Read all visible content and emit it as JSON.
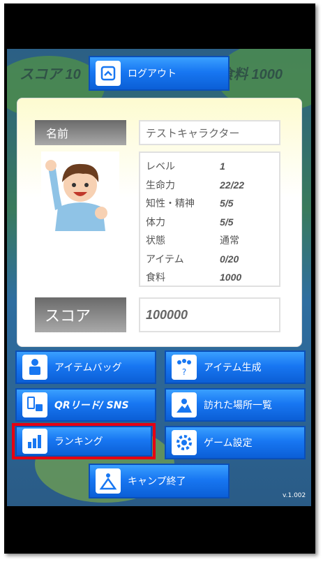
{
  "header": {
    "bg_score": "スコア 10",
    "bg_food": "食料 1000",
    "logout_label": "ログアウト"
  },
  "profile": {
    "name_label": "名前",
    "name_value": "テストキャラクター",
    "stats": [
      {
        "key": "レベル",
        "value": "1"
      },
      {
        "key": "生命力",
        "value": "22/22"
      },
      {
        "key": "知性・精神",
        "value": "5/5"
      },
      {
        "key": "体力",
        "value": "5/5"
      },
      {
        "key": "状態",
        "value": "通常"
      },
      {
        "key": "アイテム",
        "value": "0/20"
      },
      {
        "key": "食料",
        "value": "1000"
      }
    ],
    "score_label": "スコア",
    "score_value": "100000"
  },
  "menu": {
    "item_bag": "アイテムバッグ",
    "item_create": "アイテム生成",
    "qr_sns": "QRリード/ SNS",
    "visited_places": "訪れた場所一覧",
    "ranking": "ランキング",
    "game_settings": "ゲーム設定",
    "camp_end": "キャンプ終了"
  },
  "version": "v.1.002",
  "colors": {
    "button_blue": "#1877f2",
    "highlight_red": "#e60012"
  }
}
